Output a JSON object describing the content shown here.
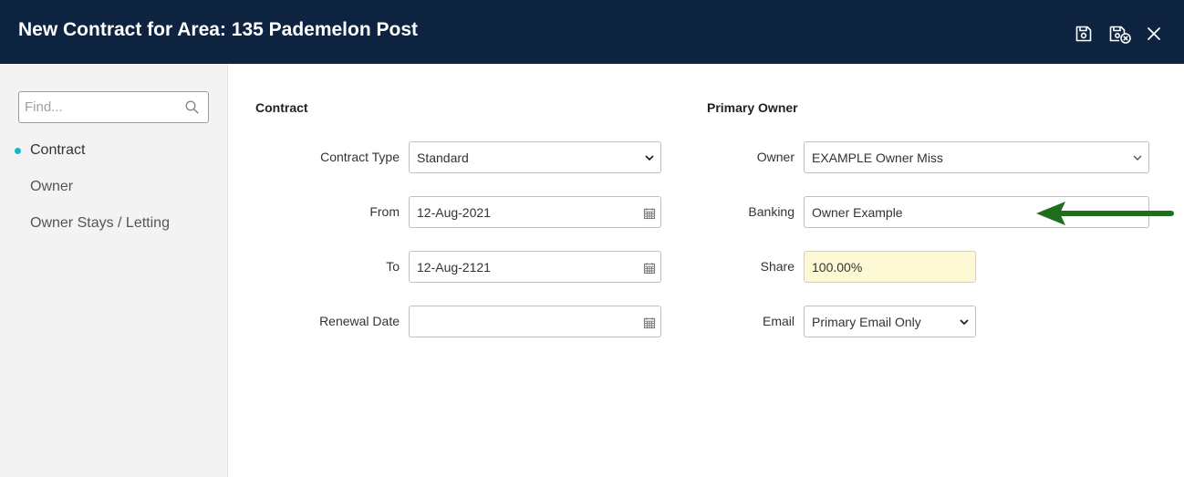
{
  "header": {
    "title": "New Contract for Area: 135 Pademelon Post",
    "icons": [
      "save-icon",
      "save-close-icon",
      "close-icon"
    ]
  },
  "sidebar": {
    "search_placeholder": "Find...",
    "items": [
      {
        "label": "Contract",
        "active": true
      },
      {
        "label": "Owner",
        "active": false
      },
      {
        "label": "Owner Stays / Letting",
        "active": false
      }
    ]
  },
  "contract": {
    "title": "Contract",
    "type_label": "Contract Type",
    "type_value": "Standard",
    "from_label": "From",
    "from_value": "12-Aug-2021",
    "to_label": "To",
    "to_value": "12-Aug-2121",
    "renewal_label": "Renewal Date",
    "renewal_value": ""
  },
  "owner": {
    "title": "Primary Owner",
    "owner_label": "Owner",
    "owner_value": "EXAMPLE Owner Miss",
    "banking_label": "Banking",
    "banking_value": "Owner Example",
    "share_label": "Share",
    "share_value": "100.00%",
    "email_label": "Email",
    "email_value": "Primary Email Only"
  },
  "colors": {
    "header_bg": "#0d2340",
    "active_dot": "#1ab5c4",
    "share_bg": "#fdf9d4",
    "arrow": "#1e6e1e"
  }
}
